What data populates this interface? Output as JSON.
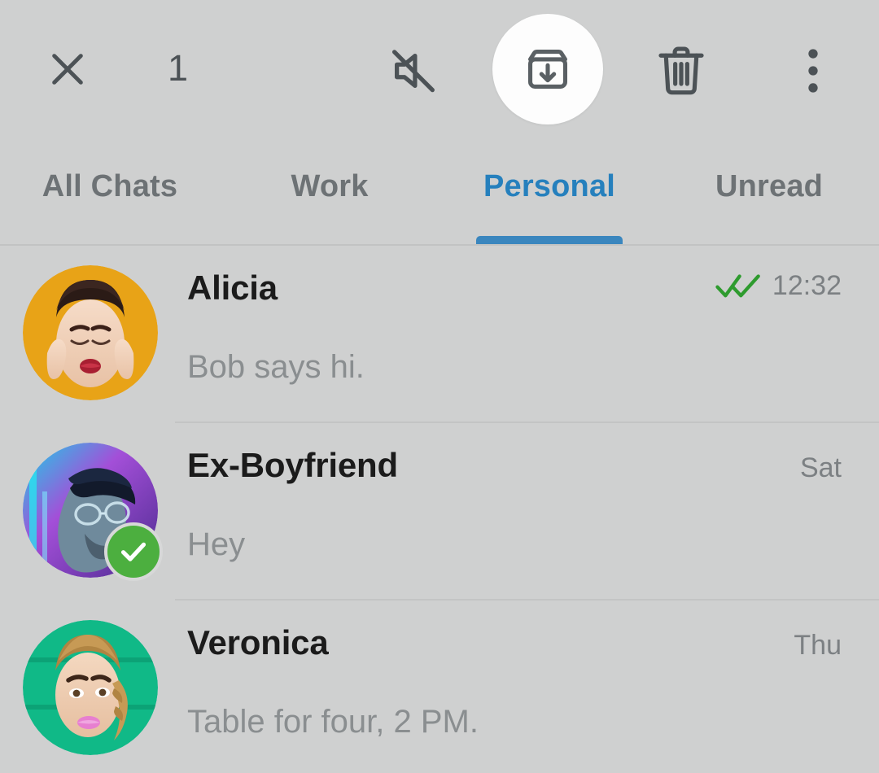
{
  "theme": {
    "background": "#cfd0d0",
    "accent": "#2680bd",
    "underline": "#3a86be",
    "icon": "#4c5256",
    "name_color": "#1b1b1b",
    "preview_color": "#8a8e90",
    "time_color": "#7c8083",
    "tick_green": "#2e9b2e",
    "badge_green": "#4caf3f",
    "fab_background": "#fdfdfd"
  },
  "action_bar": {
    "close_icon": "close-icon",
    "selection_count": "1",
    "actions": [
      {
        "name": "mute-button",
        "icon": "mute-bell-off-icon",
        "label": "Mute"
      },
      {
        "name": "archive-button",
        "icon": "archive-box-down-arrow-icon",
        "label": "Archive",
        "highlighted": true
      },
      {
        "name": "delete-button",
        "icon": "trash-icon",
        "label": "Delete"
      },
      {
        "name": "more-options-button",
        "icon": "more-vertical-icon",
        "label": "More options"
      }
    ]
  },
  "tabs": [
    {
      "label": "All Chats",
      "active": false
    },
    {
      "label": "Work",
      "active": false
    },
    {
      "label": "Personal",
      "active": true
    },
    {
      "label": "Unread",
      "active": false
    }
  ],
  "chats": [
    {
      "name": "Alicia",
      "preview": "Bob says hi.",
      "time": "12:32",
      "read_receipt": "double-check-icon",
      "selected": false,
      "avatar_bg": "#e8a317"
    },
    {
      "name": "Ex-Boyfriend",
      "preview": "Hey",
      "time": "Sat",
      "read_receipt": "",
      "selected": true,
      "avatar_bg": "#8a5ec8"
    },
    {
      "name": "Veronica",
      "preview": "Table for four, 2 PM.",
      "time": "Thu",
      "read_receipt": "",
      "selected": false,
      "avatar_bg": "#10b987"
    }
  ]
}
